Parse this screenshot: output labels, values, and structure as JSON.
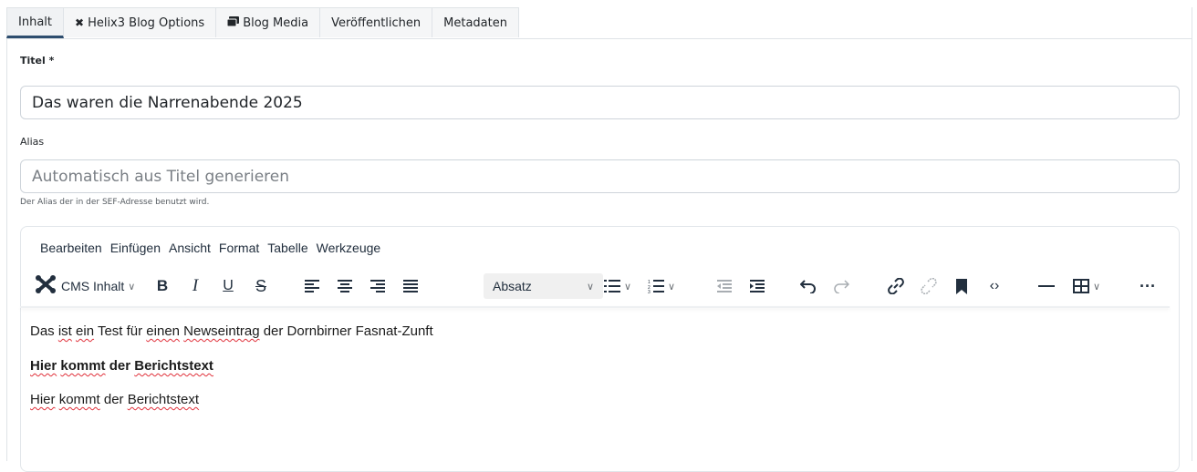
{
  "tabs": [
    {
      "label": "Inhalt",
      "active": true,
      "icon": ""
    },
    {
      "label": "Helix3 Blog Options",
      "active": false,
      "icon": "helix-icon"
    },
    {
      "label": "Blog Media",
      "active": false,
      "icon": "media-icon"
    },
    {
      "label": "Veröffentlichen",
      "active": false,
      "icon": ""
    },
    {
      "label": "Metadaten",
      "active": false,
      "icon": ""
    }
  ],
  "title_field": {
    "label": "Titel *",
    "value": "Das waren die Narrenabende 2025"
  },
  "alias_field": {
    "label": "Alias",
    "placeholder": "Automatisch aus Titel generieren",
    "hint": "Der Alias der in der SEF-Adresse benutzt wird."
  },
  "editor": {
    "menu": [
      "Bearbeiten",
      "Einfügen",
      "Ansicht",
      "Format",
      "Tabelle",
      "Werkzeuge"
    ],
    "cms_label": "CMS Inhalt",
    "block_format": "Absatz",
    "icons": [
      "joomla-icon",
      "bold-icon",
      "italic-icon",
      "underline-icon",
      "strikethrough-icon",
      "align-left-icon",
      "align-center-icon",
      "align-right-icon",
      "align-justify-icon",
      "bullet-list-icon",
      "numbered-list-icon",
      "outdent-icon",
      "indent-icon",
      "undo-icon",
      "redo-icon",
      "link-icon",
      "unlink-icon",
      "bookmark-icon",
      "code-icon",
      "horizontal-line-icon",
      "table-icon",
      "more-icon"
    ],
    "paragraphs": [
      {
        "parts": [
          "Das ",
          "ist",
          " ",
          "ein",
          " Test für ",
          "einen",
          " ",
          "Newseintrag",
          " der Dornbirner Fasnat-Zunft"
        ]
      },
      {
        "parts": [
          "Hier",
          " ",
          "kommt",
          " der ",
          "Berichtstext"
        ],
        "bold": true
      },
      {
        "parts": [
          "Hier",
          " ",
          "kommt",
          " der ",
          "Berichtstext"
        ]
      }
    ]
  },
  "colors": {
    "active_tab_border": "#2d4d6e",
    "spellcheck": "#e0303a"
  }
}
